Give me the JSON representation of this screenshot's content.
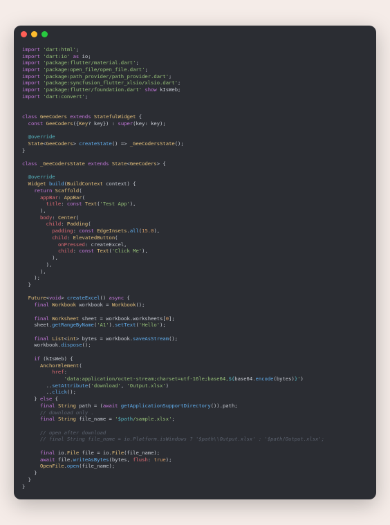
{
  "window": {
    "dots": [
      "close",
      "minimize",
      "maximize"
    ]
  },
  "code": {
    "imports": [
      {
        "pkg": "'dart:html'",
        "suffix": ";"
      },
      {
        "pkg": "'dart:io'",
        "suffix": " as io;"
      },
      {
        "pkg": "'package:flutter/material.dart'",
        "suffix": ";"
      },
      {
        "pkg": "'package:open_file/open_file.dart'",
        "suffix": ";"
      },
      {
        "pkg": "'package:path_provider/path_provider.dart'",
        "suffix": ";"
      },
      {
        "pkg": "'package:syncfusion_flutter_xlsio/xlsio.dart'",
        "suffix": ";"
      },
      {
        "pkg": "'package:flutter/foundation.dart'",
        "suffix": " show kIsWeb;"
      },
      {
        "pkg": "'dart:convert'",
        "suffix": ";"
      }
    ],
    "class1_decl": "class GeeCoders extends StatefulWidget {",
    "class1_ctor": "  const GeeCoders({Key? key}) : super(key: key);",
    "override": "  @override",
    "createState": "  State<GeeCoders> createState() => _GeeCodersState();",
    "class2_decl": "class _GeeCodersState extends State<GeeCoders> {",
    "build_sig": "  Widget build(BuildContext context) {",
    "return_scaffold": "    return Scaffold(",
    "appbar": "      appBar: AppBar(",
    "title": "        title: const Text('Test App'),",
    "body_center": "      body: Center(",
    "child_padding": "        child: Padding(",
    "padding_val": "          padding: const EdgeInsets.all(15.0),",
    "child_button": "          child: ElevatedButton(",
    "onpressed": "            onPressed: createExcel,",
    "child_text": "            child: const Text('Click Me'),",
    "future_sig": "  Future<void> createExcel() async {",
    "workbook": "    final Workbook workbook = Workbook();",
    "worksheet": "    final Worksheet sheet = workbook.worksheets[0];",
    "setrange": "    sheet.getRangeByName('A1').setText('Hello');",
    "bytes": "    final List<int> bytes = workbook.saveAsStream();",
    "dispose": "    workbook.dispose();",
    "if_web": "    if (kIsWeb) {",
    "anchor": "      AnchorElement(",
    "href": "          href:",
    "href_val": "              'data:application/octet-stream;charset=utf-16le;base64,${base64.encode(bytes)}')",
    "setattr": "        ..setAttribute('download', 'Output.xlsx')",
    "click": "        ..click();",
    "else": "    } else {",
    "path": "      final String path = (await getApplicationSupportDirectory()).path;",
    "cmt1": "      // download only .",
    "filename": "      final String file_name = '$path/sample.xlsx';",
    "cmt2": "      // open after download",
    "cmt3": "      // final String file_name = io.Platform.isWindows ? '$path\\\\Output.xlsx' : '$path/Output.xlsx';",
    "file": "      final io.File file = io.File(file_name);",
    "write": "      await file.writeAsBytes(bytes, flush: true);",
    "open": "      OpenFile.open(file_name);"
  }
}
